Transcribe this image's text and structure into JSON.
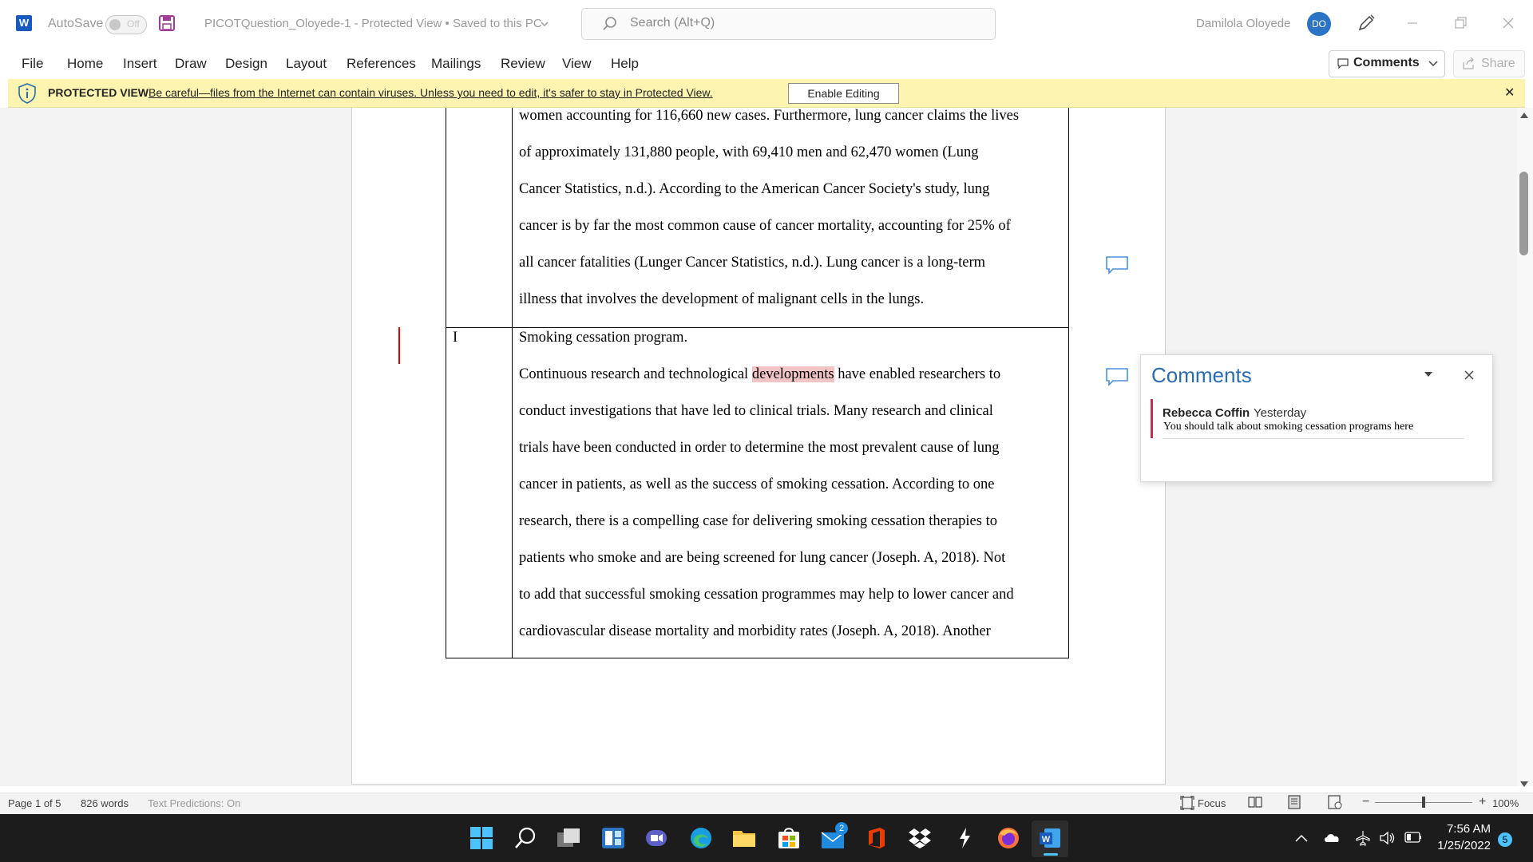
{
  "titlebar": {
    "autosave_label": "AutoSave",
    "autosave_state": "Off",
    "document_title": "PICOTQuestion_Oloyede-1  -  Protected View • Saved to this PC",
    "search_placeholder": "Search (Alt+Q)",
    "user_name": "Damilola  Oloyede",
    "user_initials": "DO"
  },
  "ribbon": {
    "tabs": [
      "File",
      "Home",
      "Insert",
      "Draw",
      "Design",
      "Layout",
      "References",
      "Mailings",
      "Review",
      "View",
      "Help"
    ],
    "comments_label": "Comments",
    "share_label": "Share"
  },
  "protected_view": {
    "title": "PROTECTED VIEW",
    "message": "Be careful—files from the Internet can contain viruses. Unless you need to edit, it's safer to stay in Protected View.",
    "enable_button": "Enable Editing"
  },
  "document": {
    "row1_lines": [
      "women accounting for 116,660 new cases. Furthermore, lung cancer claims the lives",
      "of approximately 131,880 people, with 69,410 men and 62,470 women (Lung",
      "Cancer Statistics, n.d.). According to the American Cancer Society's study, lung",
      "cancer is by far the most common cause of cancer mortality, accounting for 25% of",
      "all cancer fatalities (Lunger Cancer Statistics, n.d.). Lung cancer is a long-term",
      "illness that involves the development of malignant cells in the lungs."
    ],
    "row2_letter": "I",
    "row2_heading": "Smoking cessation program.",
    "row2_first_pre": "Continuous research and technological ",
    "row2_first_highlight": "developments",
    "row2_first_post": " have enabled researchers to",
    "row2_lines": [
      "conduct investigations that have led to clinical trials. Many research and clinical",
      "trials have been conducted in order to determine the most prevalent cause of lung",
      "cancer in patients, as well as the success of smoking cessation. According to one",
      "research, there is a compelling case for delivering smoking cessation therapies to",
      "patients who smoke and are being screened for lung cancer (Joseph. A, 2018). Not",
      "to add that successful smoking cessation programmes may help to lower cancer and",
      "cardiovascular disease mortality and morbidity rates (Joseph. A, 2018). Another"
    ]
  },
  "comments_pane": {
    "title": "Comments",
    "author": "Rebecca Coffin",
    "time": "Yesterday",
    "text": "You should talk about smoking cessation programs here"
  },
  "statusbar": {
    "page": "Page 1 of 5",
    "words": "826 words",
    "predictions": "Text Predictions: On",
    "focus": "Focus",
    "zoom": "100%"
  },
  "taskbar": {
    "time": "7:56 AM",
    "date": "1/25/2022",
    "mail_badge": "2",
    "notif_count": "5"
  },
  "colors": {
    "brand_blue": "#185abd",
    "protected_yellow": "#fcf4b0",
    "highlight": "#f3c4c6",
    "comment_accent": "#c4314b"
  }
}
